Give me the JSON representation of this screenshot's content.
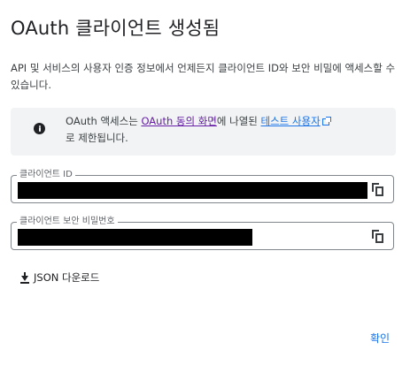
{
  "dialog": {
    "title": "OAuth 클라이언트 생성됨",
    "description": "API 및 서비스의 사용자 인증 정보에서 언제든지 클라이언트 ID와 보안 비밀에 액세스할 수 있습니다."
  },
  "info": {
    "icon": "info-icon",
    "text_before": "OAuth 액세스는 ",
    "consent_link": "OAuth 동의 화면",
    "text_middle": "에 나열된 ",
    "test_users_link": "테스트 사용자",
    "text_after": "로 제한됩니다."
  },
  "client_id": {
    "label": "클라이언트 ID",
    "copy_icon": "copy-icon"
  },
  "client_secret": {
    "label": "클라이언트 보안 비밀번호",
    "copy_icon": "copy-icon"
  },
  "download": {
    "icon": "download-icon",
    "label": "JSON 다운로드"
  },
  "confirm": {
    "label": "확인"
  },
  "colors": {
    "accent": "#1a73e8",
    "visited_link": "#681da8",
    "info_bg": "#f1f3f4"
  }
}
